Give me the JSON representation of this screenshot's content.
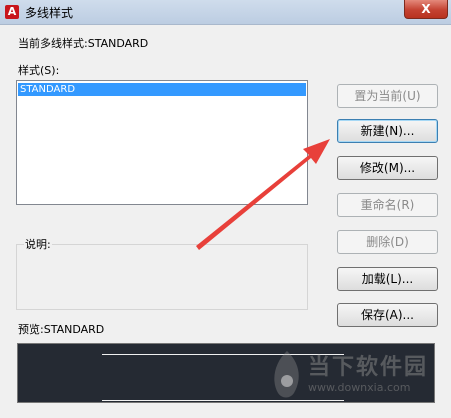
{
  "window": {
    "title": "多线样式",
    "close_label": "X"
  },
  "current_style": {
    "label": "当前多线样式:",
    "value": "STANDARD"
  },
  "styles": {
    "label": "样式(S):",
    "items": [
      "STANDARD"
    ],
    "selected_index": 0
  },
  "description": {
    "label": "说明:",
    "value": ""
  },
  "preview": {
    "label": "预览:",
    "value": "STANDARD"
  },
  "buttons": {
    "set_current": "置为当前(U)",
    "new": "新建(N)...",
    "modify": "修改(M)...",
    "rename": "重命名(R)",
    "delete": "删除(D)",
    "load": "加载(L)...",
    "save": "保存(A)..."
  },
  "watermark": {
    "text": "当下软件园",
    "url": "www.downxia.com"
  },
  "colors": {
    "selection": "#3399ff",
    "preview_bg": "#252a33",
    "annotation_arrow": "#e8403a"
  }
}
